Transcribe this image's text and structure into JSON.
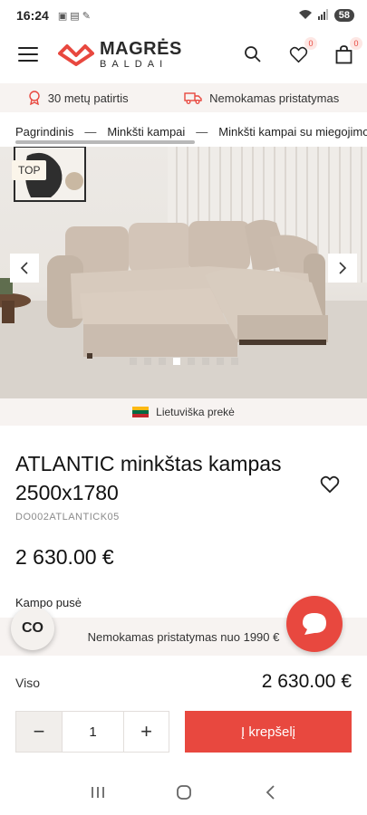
{
  "status_bar": {
    "time": "16:24",
    "battery": "58"
  },
  "header": {
    "logo_line1": "MAGRĖS",
    "logo_line2": "BALDAI",
    "wishlist_count": "0",
    "cart_count": "0"
  },
  "benefits": {
    "experience": "30 metų patirtis",
    "delivery": "Nemokamas pristatymas"
  },
  "breadcrumb": [
    "Pagrindinis",
    "Minkšti kampai",
    "Minkšti kampai su miegojimo"
  ],
  "gallery": {
    "badge": "TOP",
    "slide_count": 8,
    "active_slide": 4
  },
  "origin": {
    "label": "Lietuviška prekė"
  },
  "product": {
    "title": "ATLANTIC minkštas kampas 2500x1780",
    "sku": "DO002ATLANTICK05",
    "price": "2 630.00 €",
    "side_label": "Kampo pusė"
  },
  "promo": {
    "free_delivery": "Nemokamas pristatymas nuo 1990 €",
    "co_label": "CO"
  },
  "summary": {
    "total_label": "Viso",
    "total_value": "2 630.00 €"
  },
  "purchase": {
    "quantity": "1",
    "minus": "−",
    "plus": "+",
    "cart_label": "Į krepšelį"
  },
  "colors": {
    "accent": "#e8483f",
    "soft_bg": "#f7f3f1"
  }
}
